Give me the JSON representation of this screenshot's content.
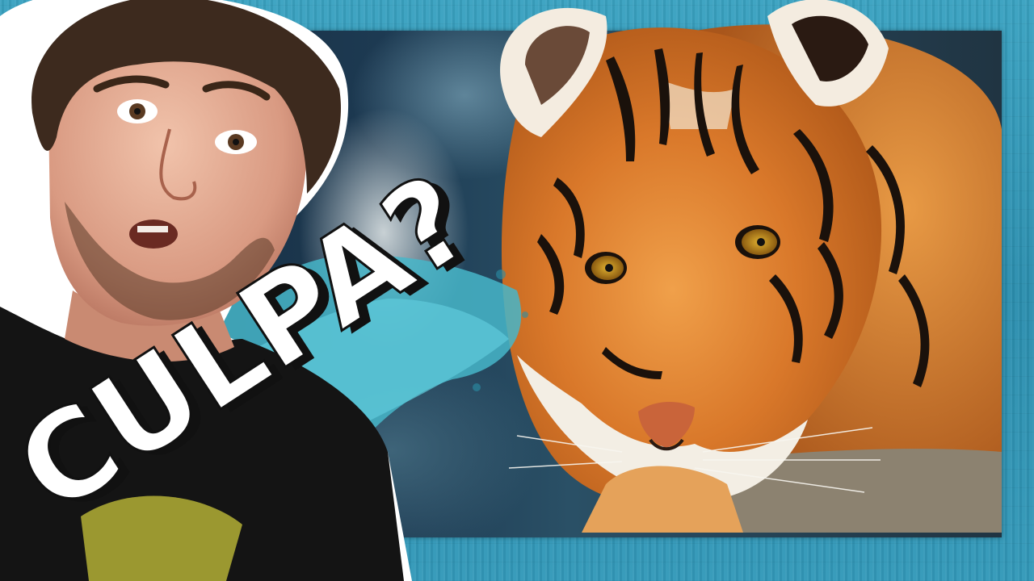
{
  "headline": {
    "text": "CULPA?"
  },
  "colors": {
    "background": "#2f93b3",
    "headline_fill": "#ffffff",
    "headline_shadow": "#111111",
    "splash": "#46b6c9",
    "tiger_orange": "#d9782a"
  },
  "scene": {
    "subjects": [
      "person",
      "tiger"
    ]
  }
}
